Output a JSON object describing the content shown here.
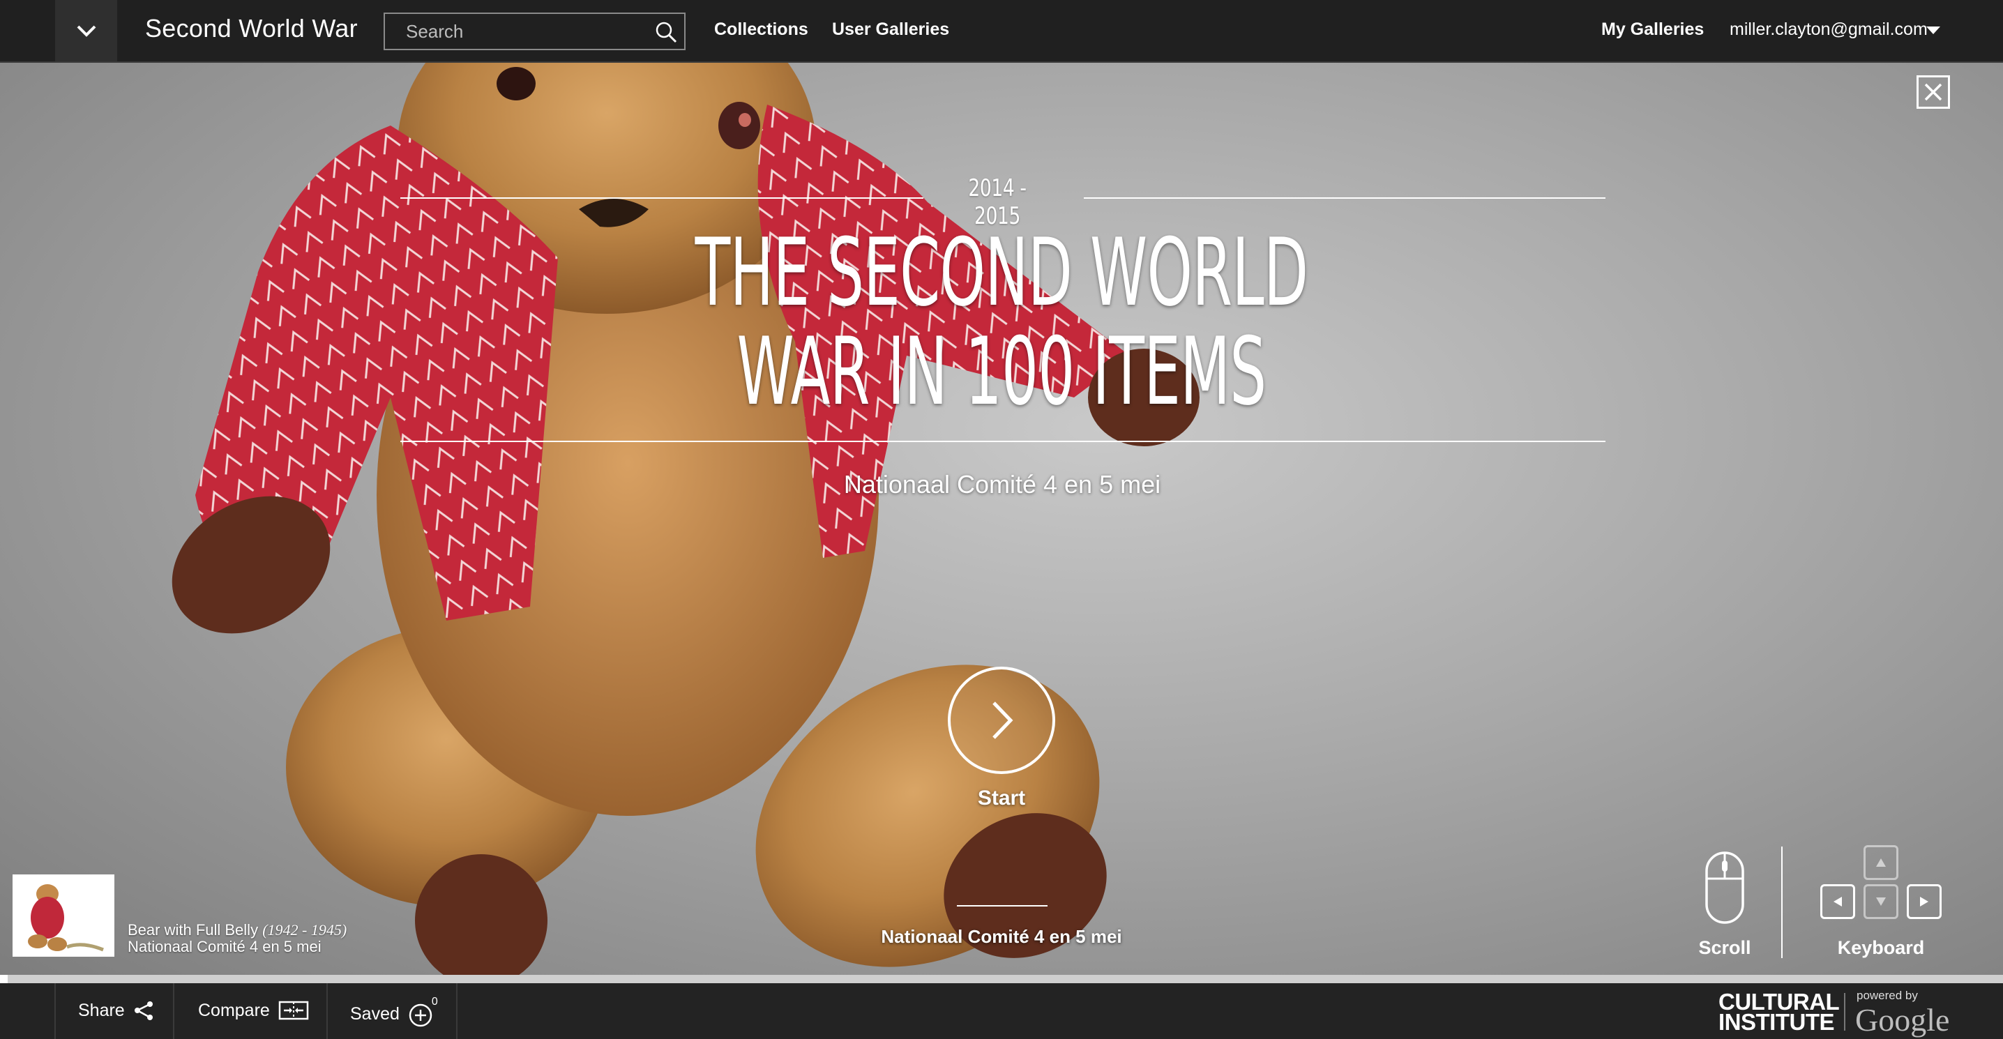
{
  "header": {
    "site_title": "Second World War",
    "search_placeholder": "Search",
    "nav": {
      "collections": "Collections",
      "user_galleries": "User Galleries"
    },
    "my_galleries": "My Galleries",
    "user_email": "miller.clayton@gmail.com"
  },
  "hero": {
    "years": "2014 - 2015",
    "title": "THE SECOND WORLD WAR IN 100 ITEMS",
    "subtitle": "Nationaal Comité 4 en 5 mei",
    "start_label": "Start",
    "provider": "Nationaal Comité 4 en 5 mei",
    "progress": 0.004
  },
  "current_item": {
    "title": "Bear with Full Belly",
    "dates": "(1942 - 1945)",
    "owner": "Nationaal Comité 4 en 5 mei"
  },
  "help": {
    "scroll": "Scroll",
    "keyboard": "Keyboard"
  },
  "footer": {
    "share": "Share",
    "compare": "Compare",
    "saved": "Saved",
    "saved_count": "0",
    "brand_line1": "CULTURAL",
    "brand_line2": "INSTITUTE",
    "powered_by": "powered by",
    "google": "Google"
  },
  "colors": {
    "topbar": "#202020",
    "bottombar": "#232323",
    "jacket_red": "#c8283a",
    "bear_fur": "#c08a4c"
  },
  "icons": [
    "chevron-down-icon",
    "search-icon",
    "caret-down-icon",
    "close-icon",
    "chevron-right-icon",
    "mouse-icon",
    "arrow-keys-icon",
    "share-icon",
    "compare-icon",
    "add-circle-icon"
  ]
}
